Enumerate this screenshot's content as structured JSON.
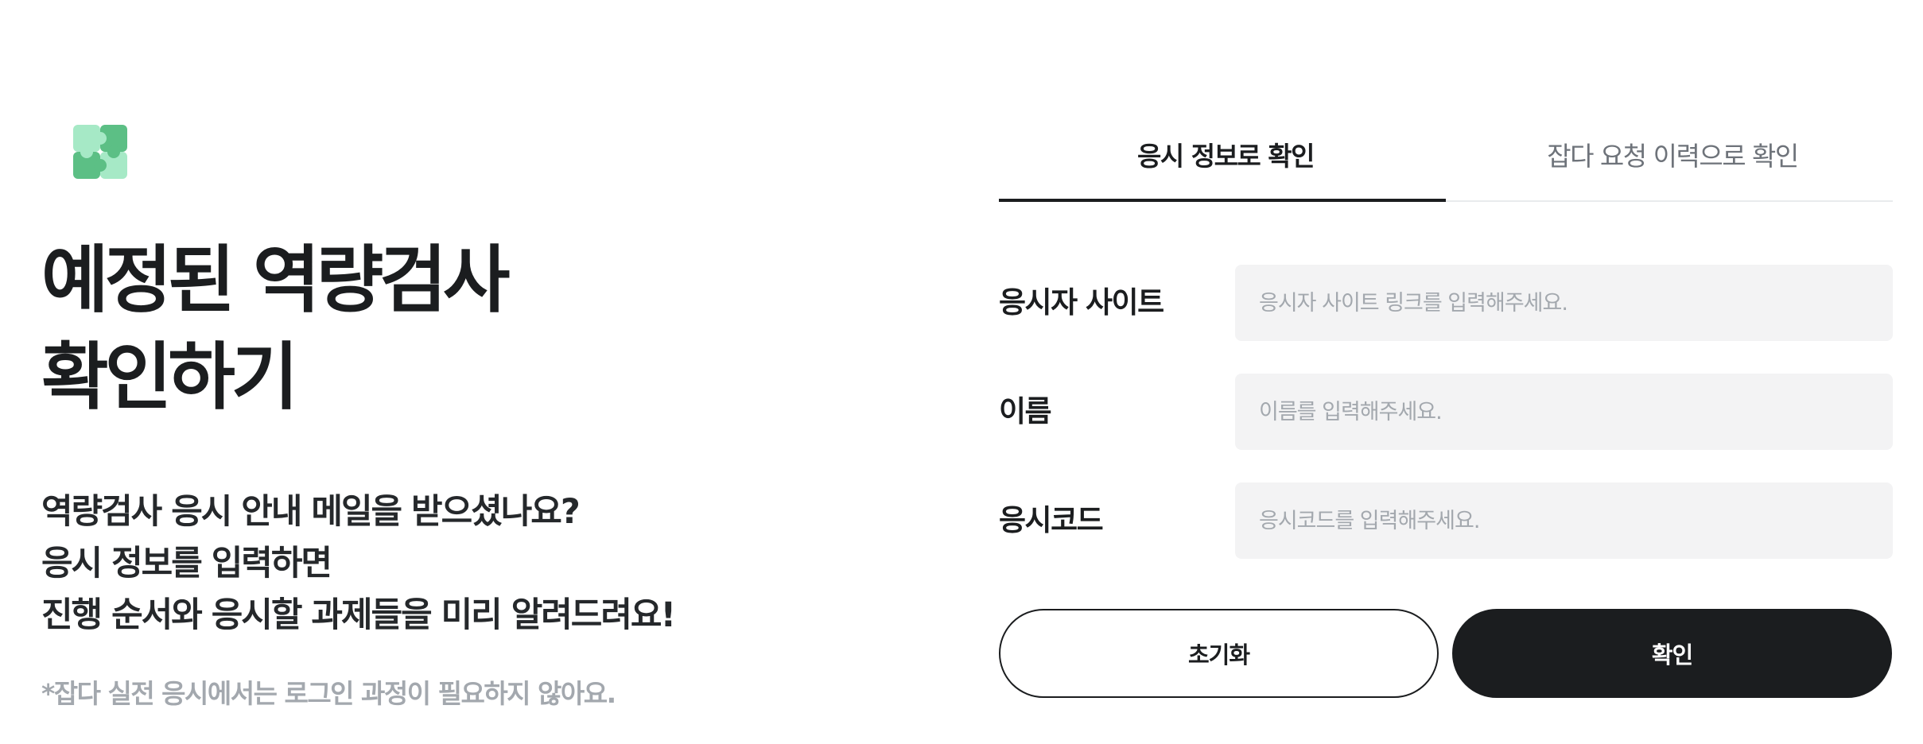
{
  "intro": {
    "logo_icon": "puzzle-icon",
    "title_lines": [
      "예정된 역량검사",
      "확인하기"
    ],
    "description_lines": [
      "역량검사 응시 안내 메일을 받으셨나요?",
      "응시 정보를 입력하면",
      "진행 순서와 응시할 과제들을 미리 알려드려요!"
    ],
    "note": "*잡다 실전 응시에서는 로그인 과정이 필요하지 않아요."
  },
  "tabs": [
    {
      "label": "응시 정보로 확인",
      "active": true
    },
    {
      "label": "잡다 요청 이력으로 확인",
      "active": false
    }
  ],
  "form": {
    "site": {
      "label": "응시자 사이트",
      "placeholder": "응시자 사이트 링크를 입력해주세요.",
      "value": ""
    },
    "name": {
      "label": "이름",
      "placeholder": "이름를 입력해주세요.",
      "value": ""
    },
    "code": {
      "label": "응시코드",
      "placeholder": "응시코드를 입력해주세요.",
      "value": ""
    }
  },
  "buttons": {
    "reset_label": "초기화",
    "confirm_label": "확인"
  },
  "colors": {
    "text_primary": "#1b1d1f",
    "text_muted": "#a3a8ae",
    "input_bg": "#f3f3f4",
    "logo_dark": "#5cbf85",
    "logo_light": "#a6e9c6"
  }
}
